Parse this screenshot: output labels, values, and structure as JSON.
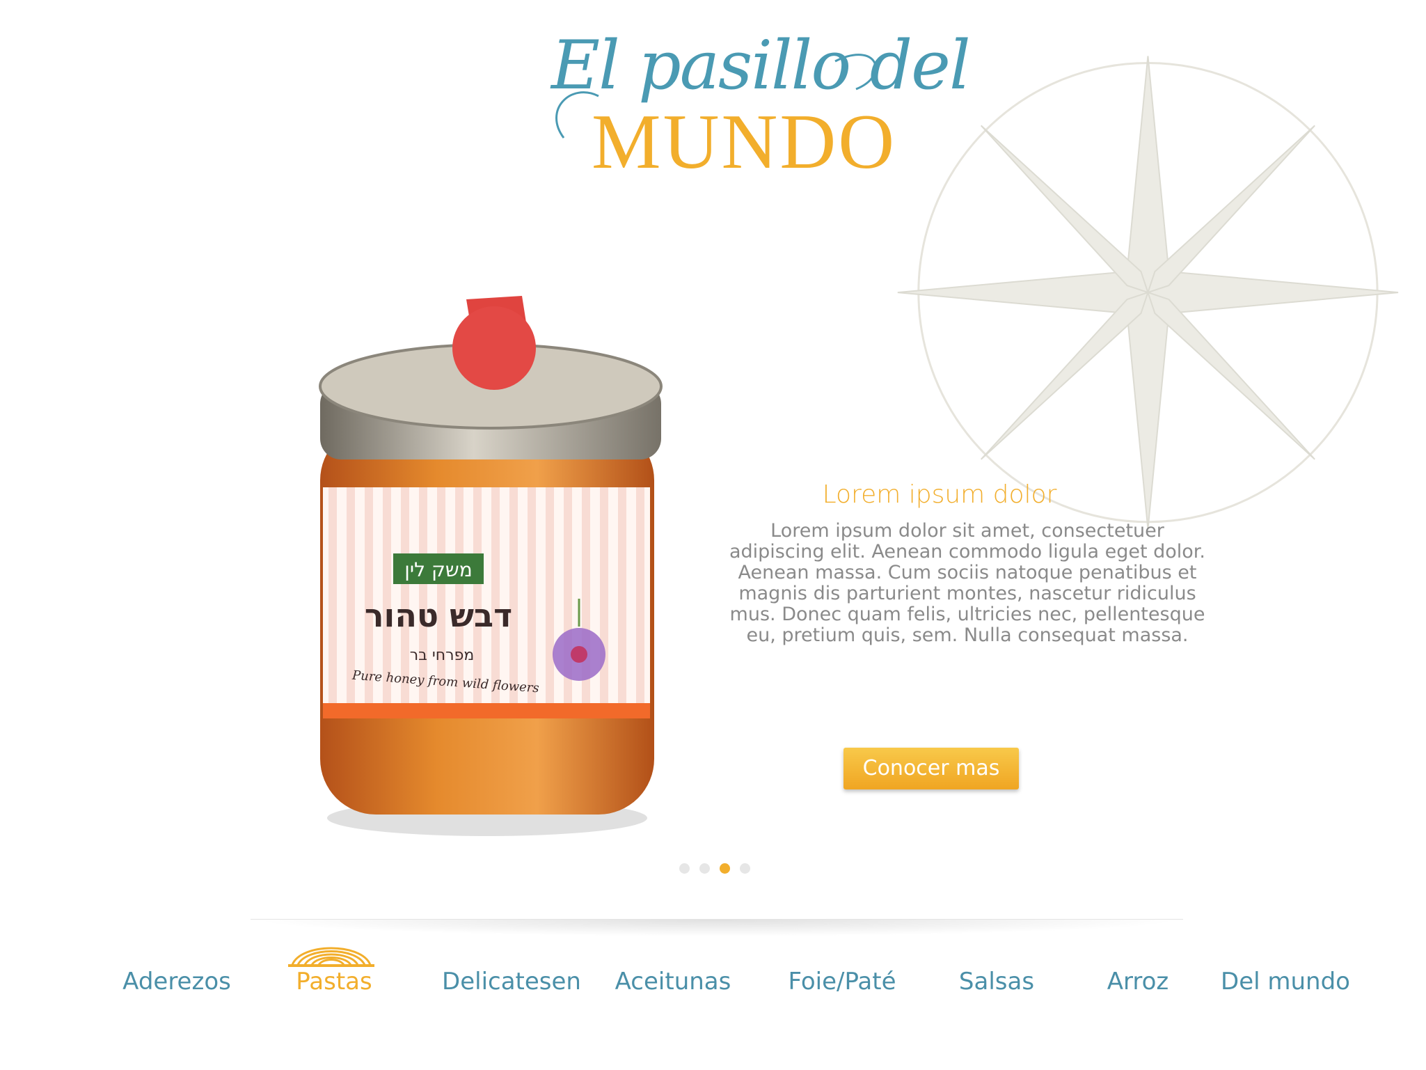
{
  "brand": {
    "script_line": "El pasillo del",
    "main_line": "MUNDO",
    "colors": {
      "teal": "#4a9ab3",
      "gold": "#f2ae2c"
    }
  },
  "product": {
    "label_brand_he": "משק לין",
    "label_title_he": "דבש טהור",
    "label_subtitle_he": "מפרחי בר",
    "label_english": "Pure honey from wild flowers"
  },
  "promo": {
    "title": "Lorem ipsum dolor",
    "body": "Lorem ipsum dolor sit amet, consectetuer adipiscing elit. Aenean commodo ligula eget dolor. Aenean massa. Cum sociis natoque penatibus et magnis dis parturient montes, nascetur ridiculus mus. Donec quam felis, ultricies nec, pellentesque eu, pretium quis, sem. Nulla consequat massa.",
    "button_label": "Conocer mas"
  },
  "slider": {
    "count": 4,
    "active_index": 2
  },
  "nav": {
    "items": [
      "Aderezos",
      "Pastas",
      "Delicatesen",
      "Aceitunas",
      "Foie/Paté",
      "Salsas",
      "Arroz",
      "Del mundo"
    ],
    "active_index": 1,
    "active_icon": "pasta-nest-icon"
  }
}
